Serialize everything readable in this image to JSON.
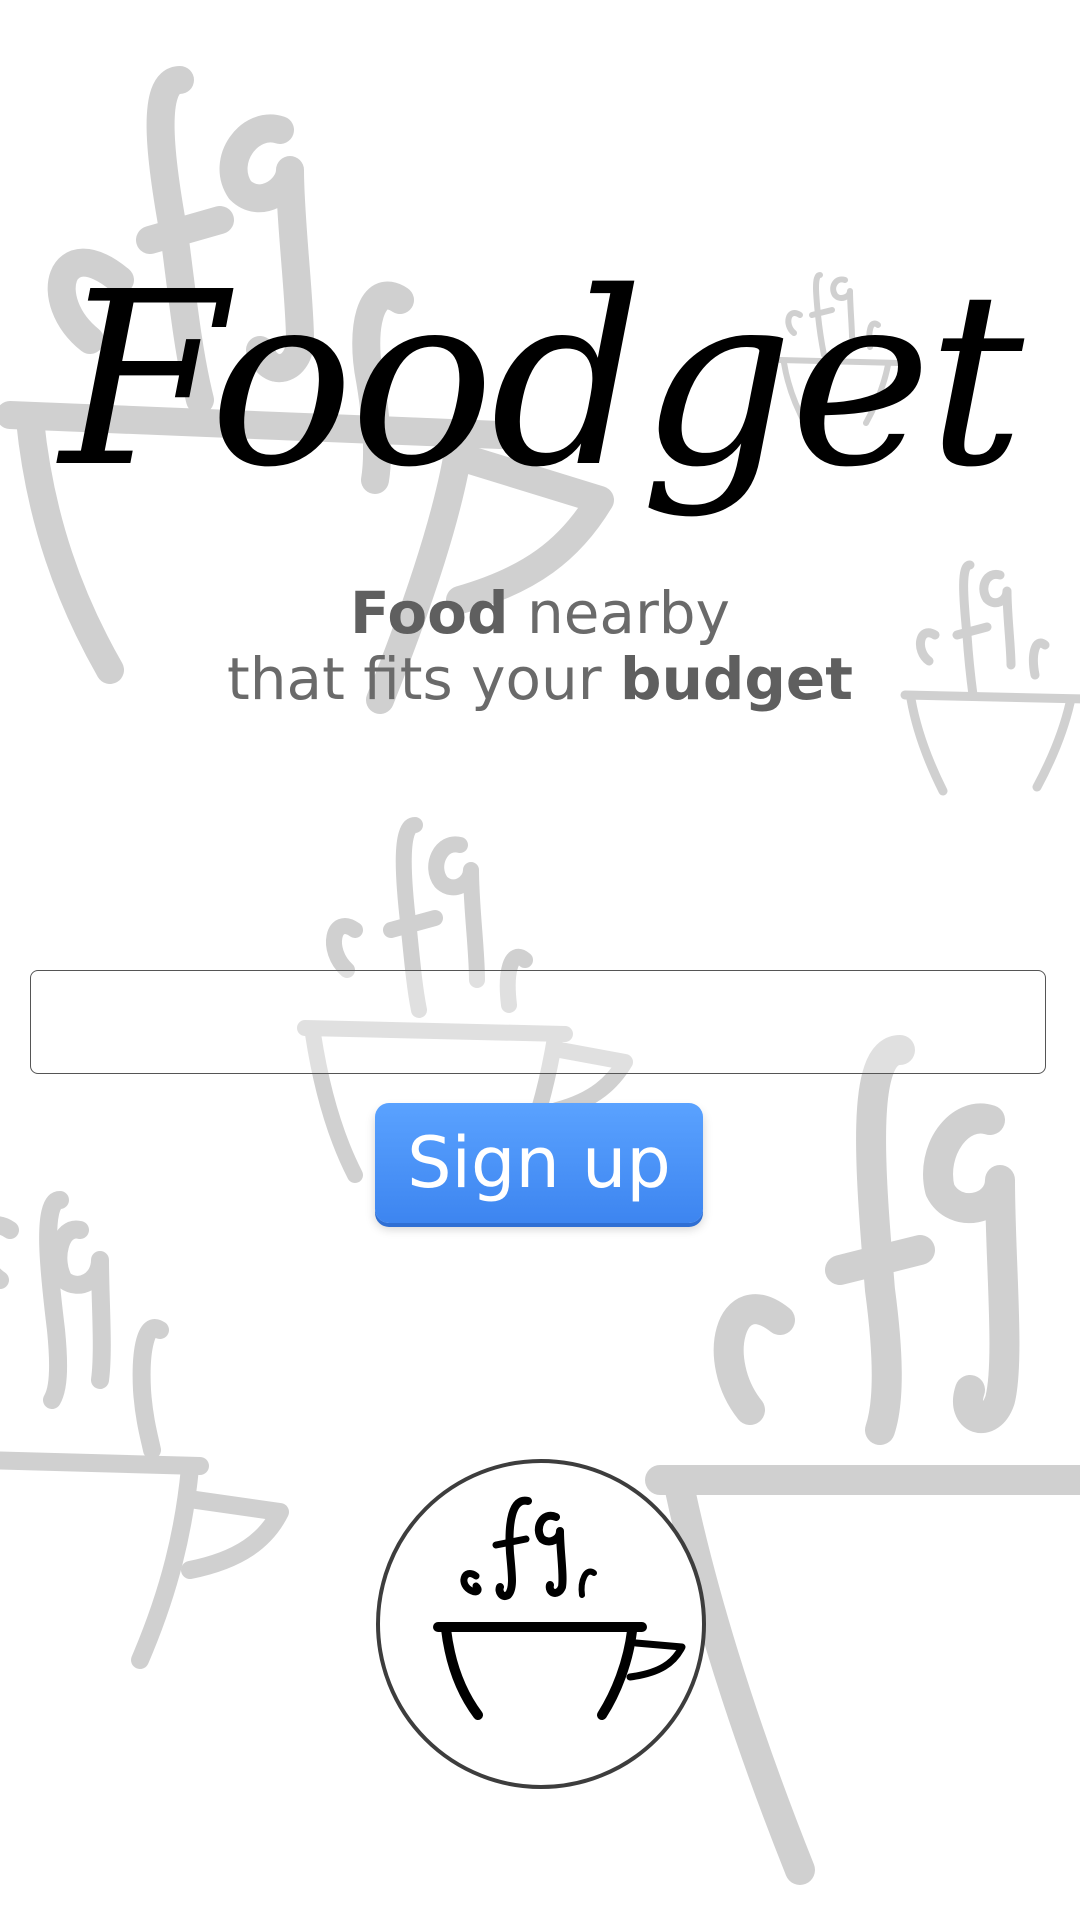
{
  "app": {
    "title": "Foodget"
  },
  "tagline": {
    "line1_bold": "Food",
    "line1_rest": " nearby",
    "line2_rest": "that fits your ",
    "line2_bold": "budget"
  },
  "signup_form": {
    "email_value": "",
    "email_placeholder": "",
    "submit_label": "Sign up"
  },
  "branding": {
    "badge_icon": "steaming-cup-icon",
    "background_icon": "steaming-cup-watermark-icon"
  },
  "colors": {
    "button_blue": "#4a90f5",
    "title_black": "#000000",
    "tagline_gray": "#6a6a6a",
    "watermark_gray": "#d0d0d0"
  }
}
